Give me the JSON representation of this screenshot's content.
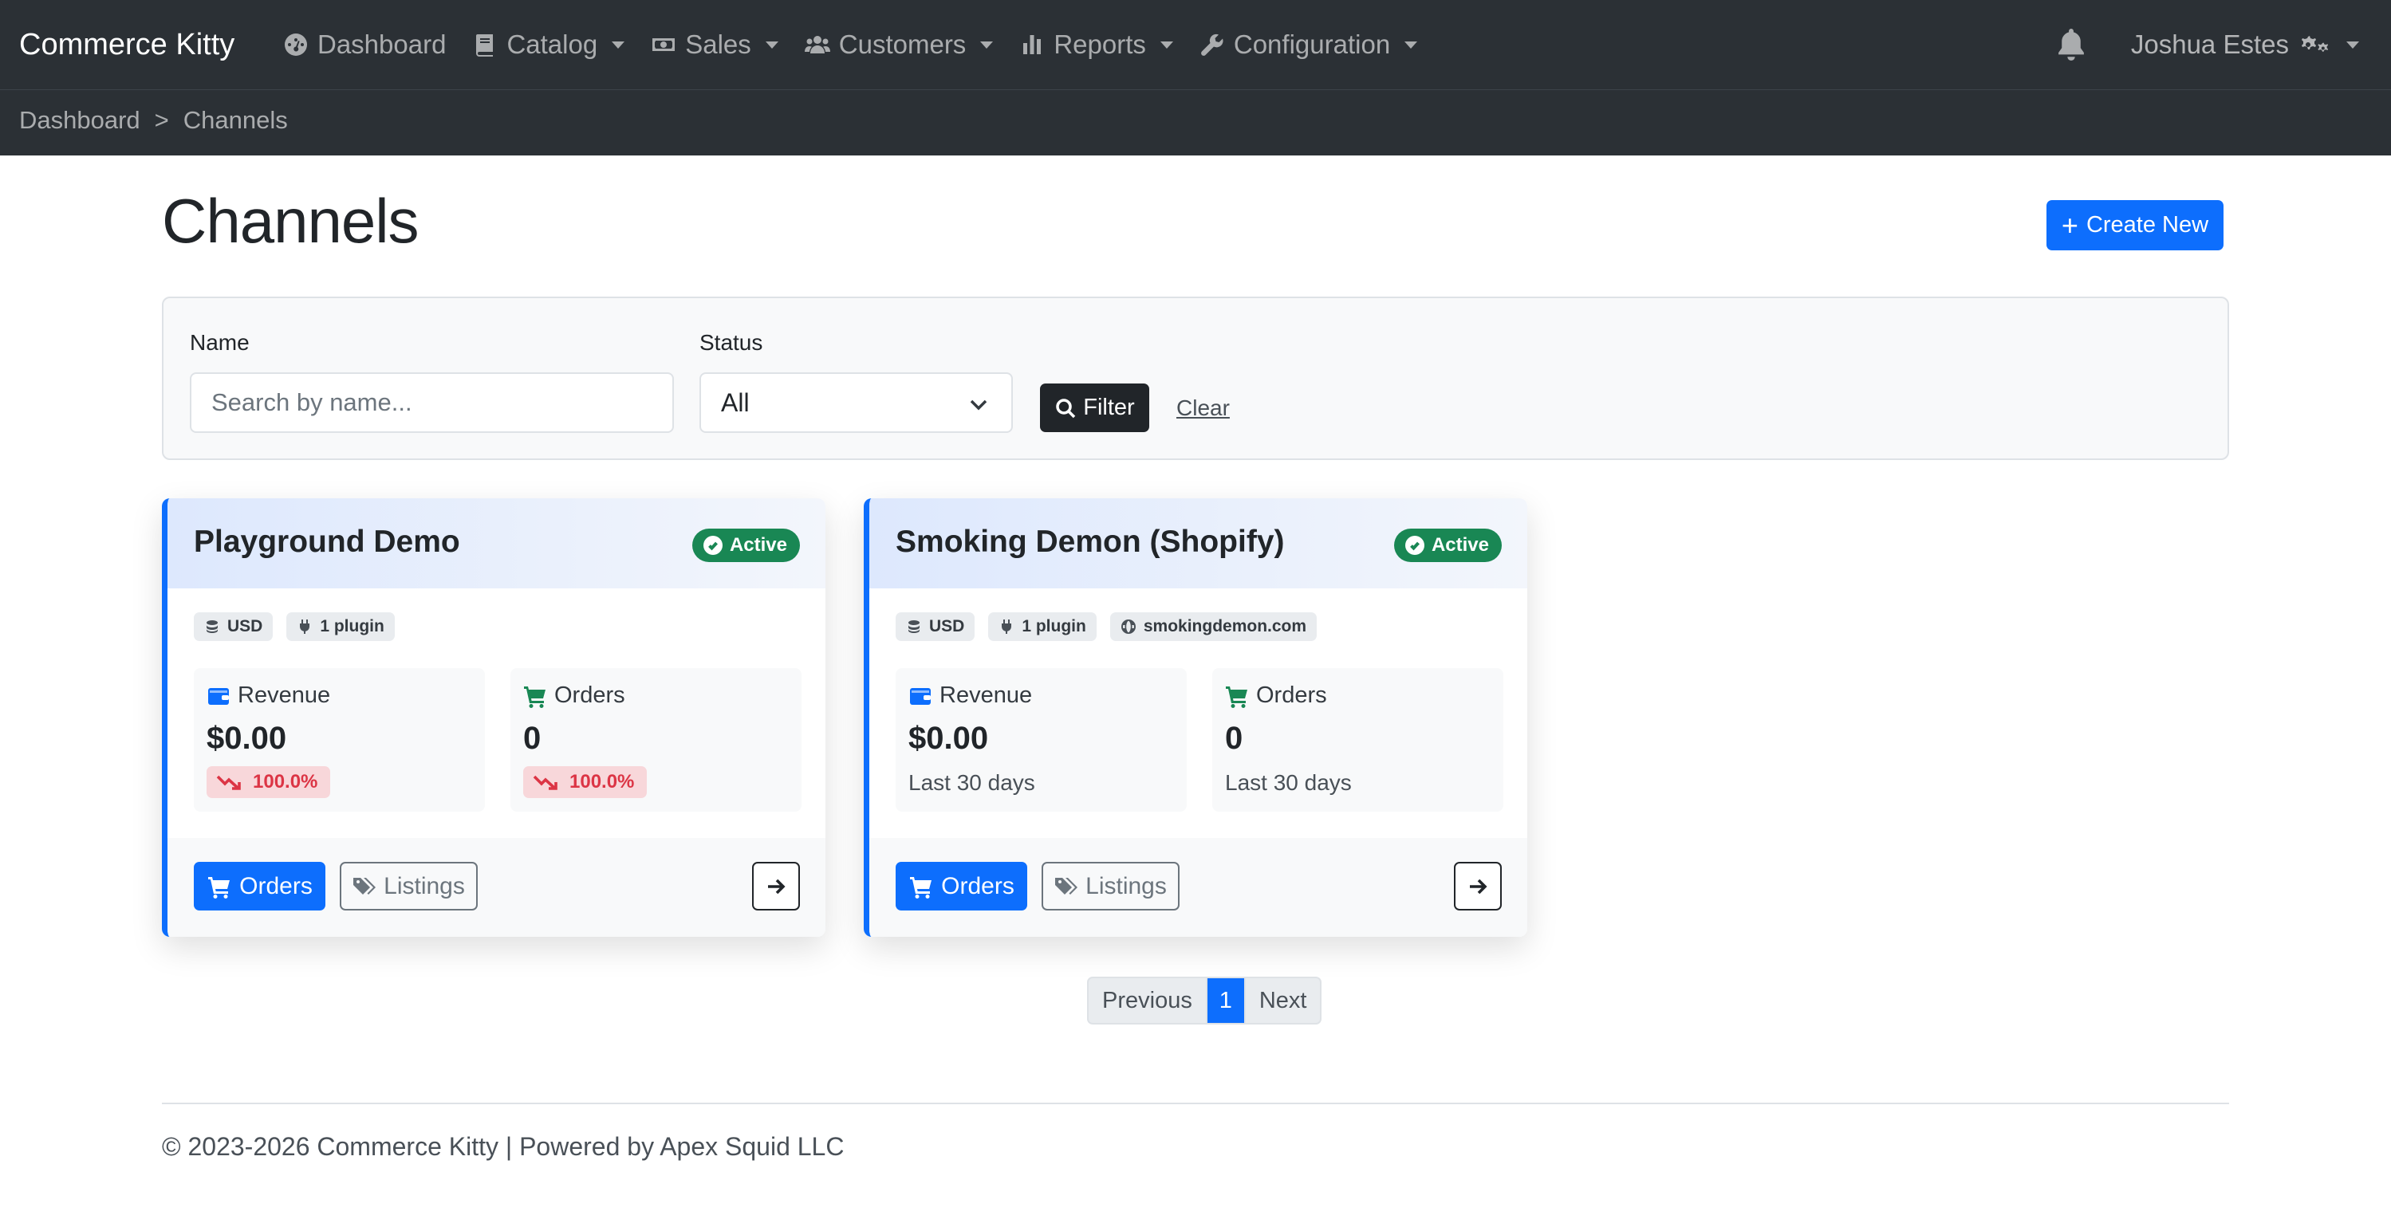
{
  "navbar": {
    "brand": "Commerce Kitty",
    "items": [
      {
        "label": "Dashboard",
        "icon": "gauge-icon",
        "dropdown": false
      },
      {
        "label": "Catalog",
        "icon": "book-icon",
        "dropdown": true
      },
      {
        "label": "Sales",
        "icon": "money-icon",
        "dropdown": true
      },
      {
        "label": "Customers",
        "icon": "users-icon",
        "dropdown": true
      },
      {
        "label": "Reports",
        "icon": "chart-bar-icon",
        "dropdown": true
      },
      {
        "label": "Configuration",
        "icon": "wrench-icon",
        "dropdown": true
      }
    ],
    "user_name": "Joshua Estes"
  },
  "breadcrumb": {
    "items": [
      "Dashboard",
      "Channels"
    ],
    "separator": ">"
  },
  "page": {
    "title": "Channels",
    "create_button": "Create New"
  },
  "filter": {
    "name_label": "Name",
    "name_placeholder": "Search by name...",
    "status_label": "Status",
    "status_value": "All",
    "filter_button": "Filter",
    "clear_link": "Clear"
  },
  "channels": [
    {
      "name": "Playground Demo",
      "status": "Active",
      "tags": [
        "USD",
        "1 plugin"
      ],
      "revenue_label": "Revenue",
      "revenue_value": "$0.00",
      "revenue_delta": "100.0%",
      "orders_label": "Orders",
      "orders_value": "0",
      "orders_delta": "100.0%",
      "orders_button": "Orders",
      "listings_button": "Listings"
    },
    {
      "name": "Smoking Demon (Shopify)",
      "status": "Active",
      "tags": [
        "USD",
        "1 plugin",
        "smokingdemon.com"
      ],
      "revenue_label": "Revenue",
      "revenue_value": "$0.00",
      "revenue_sub": "Last 30 days",
      "orders_label": "Orders",
      "orders_value": "0",
      "orders_sub": "Last 30 days",
      "orders_button": "Orders",
      "listings_button": "Listings"
    }
  ],
  "pagination": {
    "previous": "Previous",
    "current": "1",
    "next": "Next"
  },
  "footer": {
    "text": "© 2023-2026 Commerce Kitty | Powered by Apex Squid LLC"
  },
  "colors": {
    "navbar_bg": "#2b3035",
    "primary": "#0d6efd",
    "success": "#198754",
    "danger": "#dc3545"
  }
}
